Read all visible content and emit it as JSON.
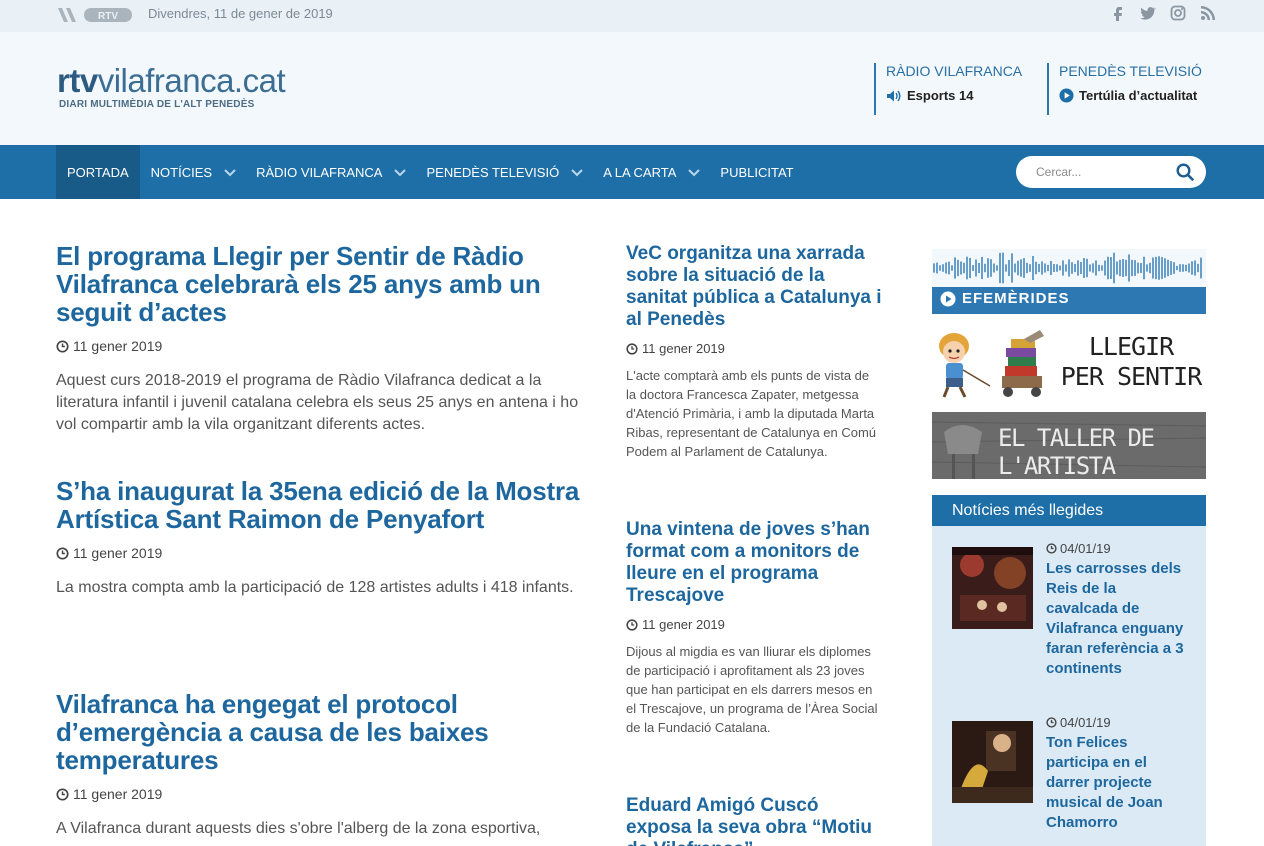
{
  "topbar": {
    "logo": "RTV",
    "date": "Divendres, 11 de gener de 2019",
    "social": [
      "facebook-icon",
      "twitter-icon",
      "instagram-icon",
      "rss-icon"
    ]
  },
  "header": {
    "brand_bold": "rtv",
    "brand_rest": "vilafranca.cat",
    "tagline": "DIARI MULTIMÈDIA DE L'ALT PENEDÈS",
    "live": [
      {
        "title": "RÀDIO VILAFRANCA",
        "program": "Esports 14"
      },
      {
        "title": "PENEDÈS TELEVISIÓ",
        "program": "Tertúlia d’actualitat"
      }
    ]
  },
  "nav": {
    "items": [
      {
        "label": "PORTADA",
        "dropdown": false
      },
      {
        "label": "NOTÍCIES",
        "dropdown": true
      },
      {
        "label": "RÀDIO VILAFRANCA",
        "dropdown": true
      },
      {
        "label": "PENEDÈS TELEVISIÓ",
        "dropdown": true
      },
      {
        "label": "A LA CARTA",
        "dropdown": true
      },
      {
        "label": "PUBLICITAT",
        "dropdown": false
      }
    ],
    "search_placeholder": "Cercar..."
  },
  "main_articles": [
    {
      "title": "El programa Llegir per Sentir de Ràdio Vilafranca celebrarà els 25 anys amb un seguit d’actes",
      "date": "11 gener 2019",
      "desc": "Aquest curs 2018-2019 el programa de Ràdio Vilafranca dedicat a la literatura infantil i juvenil catalana celebra els seus 25 anys en antena i ho vol compartir amb la vila organitzant diferents actes."
    },
    {
      "title": "S’ha inaugurat la 35ena edició de la Mostra Artística Sant Raimon de Penyafort",
      "date": "11 gener 2019",
      "desc": "La mostra compta amb la participació de 128 artistes adults i 418 infants."
    },
    {
      "title": "Vilafranca ha engegat el protocol d’emergència a causa de les baixes temperatures",
      "date": "11 gener 2019",
      "desc": "A Vilafranca durant aquests dies s'obre l'alberg de la zona esportiva,"
    }
  ],
  "mid_articles": [
    {
      "title": "VeC organitza una xarrada sobre la situació de la sanitat pública a Catalunya i al Penedès",
      "date": "11 gener 2019",
      "desc": "L'acte comptarà amb els punts de vista de la doctora Francesca Zapater, metgessa d'Atenció Primària, i amb la diputada Marta Ribas, representant de Catalunya en Comú Podem al Parlament de Catalunya."
    },
    {
      "title": "Una vintena de joves s’han format com a monitors de lleure en el programa Trescajove",
      "date": "11 gener 2019",
      "desc": "Dijous al migdia es van lliurar els diplomes de participació i aprofitament als 23 joves que han participat en els darrers mesos en el Trescajove, un programa de l’Àrea Social de la Fundació Catalana."
    },
    {
      "title": "Eduard Amigó Cuscó exposa la seva obra “Motiu de Vilafranca”",
      "date": "",
      "desc": ""
    }
  ],
  "sidebar": {
    "efemerides": "EFEMÈRIDES",
    "llegir_line1": "LLEGIR",
    "llegir_line2": "PER SENTIR",
    "taller": "EL TALLER DE L'ARTISTA",
    "most_read_title": "Notícies més llegides",
    "most_read": [
      {
        "date": "04/01/19",
        "title": "Les carrosses dels Reis de la cavalcada de Vilafranca enguany faran referència a 3 continents"
      },
      {
        "date": "04/01/19",
        "title": "Ton Felices participa en el darrer projecte musical de Joan Chamorro"
      }
    ]
  },
  "colors": {
    "brand_blue": "#1e6fa7",
    "title_blue": "#1d679e",
    "header_bg": "#f2f8fc"
  }
}
